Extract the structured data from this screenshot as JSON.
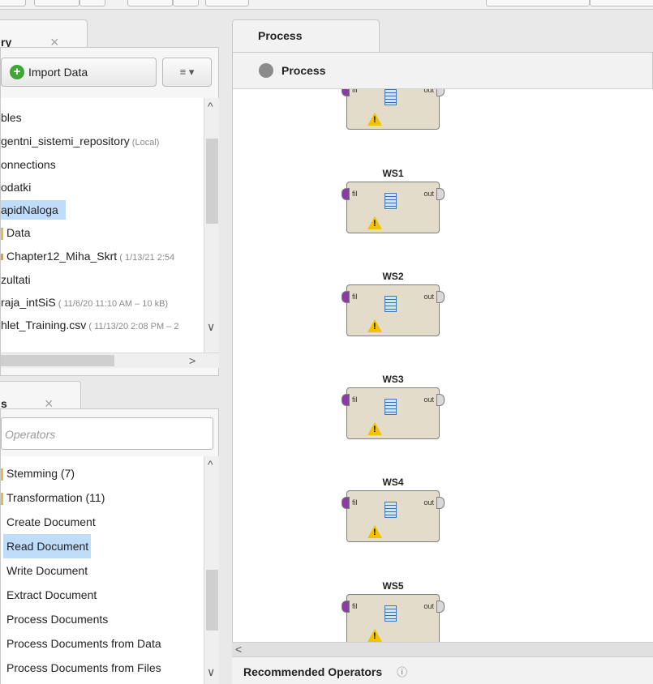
{
  "repository": {
    "tab_title": "ry",
    "import_label": "Import Data",
    "menu_label": "≡ ▾",
    "items": [
      {
        "label": "bles",
        "meta": ""
      },
      {
        "label": "gentni_sistemi_repository",
        "meta": " (Local)"
      },
      {
        "label": "onnections",
        "meta": ""
      },
      {
        "label": "odatki",
        "meta": ""
      },
      {
        "label": "apidNaloga",
        "meta": ""
      },
      {
        "label": "Data",
        "meta": ""
      },
      {
        "label": "Chapter12_Miha_Skrt",
        "meta": " ( 1/13/21 2:54"
      },
      {
        "label": "zultati",
        "meta": ""
      },
      {
        "label": "raja_intSiS",
        "meta": " ( 11/6/20 11:10 AM – 10 kB)"
      },
      {
        "label": "hlet_Training.csv",
        "meta": " ( 11/13/20 2:08 PM – 2"
      }
    ]
  },
  "operators": {
    "tab_title": "s",
    "search_placeholder": "Operators",
    "items": [
      {
        "label": "Stemming (7)"
      },
      {
        "label": "Transformation (11)"
      },
      {
        "label": "Create Document"
      },
      {
        "label": "Read Document"
      },
      {
        "label": "Write Document"
      },
      {
        "label": "Extract Document"
      },
      {
        "label": "Process Documents"
      },
      {
        "label": "Process Documents from Data"
      },
      {
        "label": "Process Documents from Files"
      }
    ]
  },
  "process": {
    "tab_title": "Process",
    "breadcrumb": "Process",
    "nodes": [
      {
        "title": "",
        "in": "fil",
        "out": "out"
      },
      {
        "title": "WS1",
        "in": "fil",
        "out": "out"
      },
      {
        "title": "WS2",
        "in": "fil",
        "out": "out"
      },
      {
        "title": "WS3",
        "in": "fil",
        "out": "out"
      },
      {
        "title": "WS4",
        "in": "fil",
        "out": "out"
      },
      {
        "title": "WS5",
        "in": "fil",
        "out": "out"
      }
    ]
  },
  "recommended": {
    "label": "Recommended Operators",
    "info": "ⓘ"
  },
  "icons": {
    "close": "×",
    "scroll_up": "^",
    "scroll_down": "∨",
    "scroll_right": ">",
    "scroll_left": "<"
  },
  "colors": {
    "selection": "#bfdcf9",
    "operator_fill": "#e3dccb",
    "input_port": "#8c3aa6",
    "warning": "#f2c200"
  }
}
